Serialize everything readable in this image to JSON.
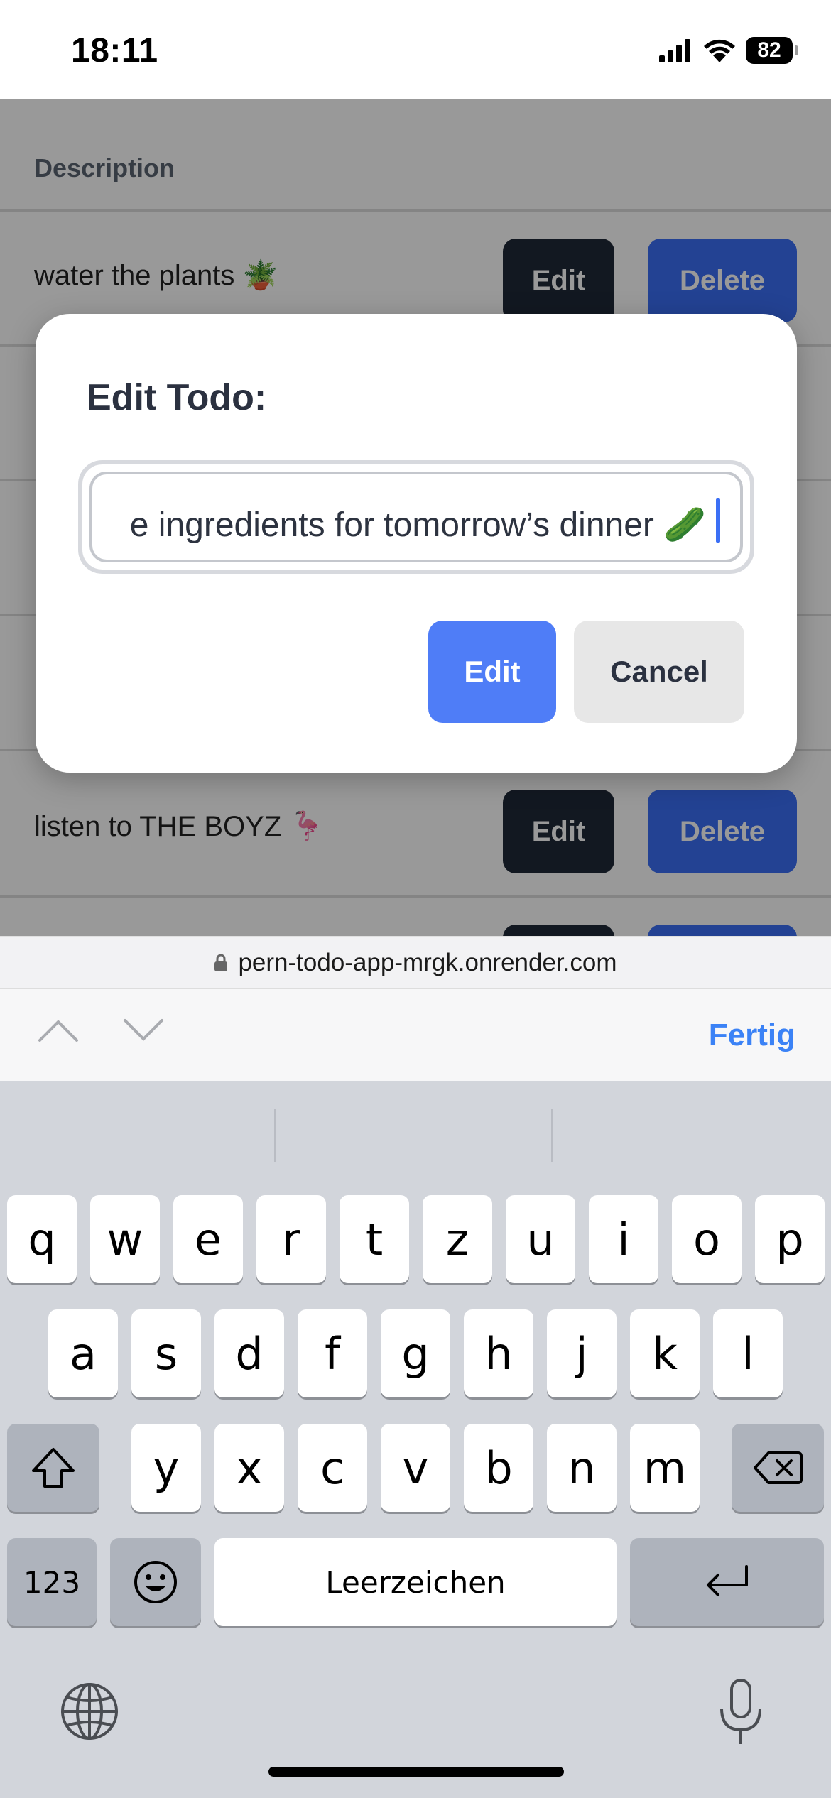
{
  "status_bar": {
    "time": "18:11",
    "battery": "82"
  },
  "todo_table": {
    "header_description": "Description",
    "rows": [
      {
        "text": "water the plants 🪴",
        "edit_label": "Edit",
        "delete_label": "Delete"
      },
      {
        "text": "listen to THE BOYZ 🦩",
        "edit_label": "Edit",
        "delete_label": "Delete"
      }
    ]
  },
  "modal": {
    "title": "Edit Todo:",
    "input_value": "e ingredients for tomorrow’s dinner 🥒",
    "edit_label": "Edit",
    "cancel_label": "Cancel"
  },
  "browser": {
    "url": "pern-todo-app-mrgk.onrender.com"
  },
  "keyboard_toolbar": {
    "done_label": "Fertig"
  },
  "keyboard": {
    "row1": [
      "q",
      "w",
      "e",
      "r",
      "t",
      "z",
      "u",
      "i",
      "o",
      "p"
    ],
    "row2": [
      "a",
      "s",
      "d",
      "f",
      "g",
      "h",
      "j",
      "k",
      "l"
    ],
    "row3": [
      "y",
      "x",
      "c",
      "v",
      "b",
      "n",
      "m"
    ],
    "numbers_label": "123",
    "space_label": "Leerzeichen"
  },
  "colors": {
    "accent_blue": "#3b6ff5",
    "dark_button": "#1f2937",
    "keyboard_bg": "#d2d5db"
  },
  "icons": [
    "signal-icon",
    "wifi-icon",
    "battery-icon",
    "lock-icon",
    "chevron-up-icon",
    "chevron-down-icon",
    "shift-icon",
    "backspace-icon",
    "emoji-icon",
    "return-icon",
    "globe-icon",
    "microphone-icon"
  ]
}
